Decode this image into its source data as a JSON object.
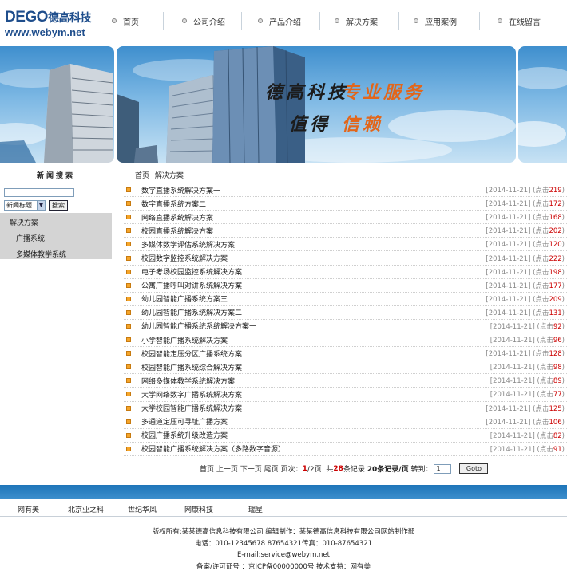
{
  "brand": {
    "name": "DEGO",
    "name_cn": "德高科技",
    "url": "www.webym.net"
  },
  "nav": [
    "首页",
    "公司介绍",
    "产品介绍",
    "解决方案",
    "应用案例",
    "在线留言"
  ],
  "banner": {
    "slogan_line1_a": "德高科技",
    "slogan_line1_b": "专业服务",
    "slogan_line2_a": "值得",
    "slogan_line2_b": "信赖"
  },
  "sidebar": {
    "news_search_title": "新闻搜索",
    "search": {
      "value": "",
      "select": "新闻标题",
      "button": "搜索"
    },
    "categories": [
      "解决方案",
      "广播系统",
      "多媒体教学系统"
    ]
  },
  "breadcrumb": "首页 解决方案",
  "articles": [
    {
      "title": "数字直播系统解决方案一",
      "date": "[2014-11-21]",
      "clicks": "219"
    },
    {
      "title": "数字直播系统方案二",
      "date": "[2014-11-21]",
      "clicks": "172"
    },
    {
      "title": "网络直播系统解决方案",
      "date": "[2014-11-21]",
      "clicks": "168"
    },
    {
      "title": "校园直播系统解决方案",
      "date": "[2014-11-21]",
      "clicks": "202"
    },
    {
      "title": "多媒体数学评估系统解决方案",
      "date": "[2014-11-21]",
      "clicks": "120"
    },
    {
      "title": "校园数字监控系统解决方案",
      "date": "[2014-11-21]",
      "clicks": "222"
    },
    {
      "title": "电子考场校园监控系统解决方案",
      "date": "[2014-11-21]",
      "clicks": "198"
    },
    {
      "title": "公寓广播呼叫对讲系统解决方案",
      "date": "[2014-11-21]",
      "clicks": "177"
    },
    {
      "title": "幼儿园智能广播系统方案三",
      "date": "[2014-11-21]",
      "clicks": "209"
    },
    {
      "title": "幼儿园智能广播系统解决方案二",
      "date": "[2014-11-21]",
      "clicks": "131"
    },
    {
      "title": "幼儿园智能广播系统系统解决方案一",
      "date": "[2014-11-21]",
      "clicks": "92"
    },
    {
      "title": "小学智能广播系统解决方案",
      "date": "[2014-11-21]",
      "clicks": "96"
    },
    {
      "title": "校园智能定压分区广播系统方案",
      "date": "[2014-11-21]",
      "clicks": "128"
    },
    {
      "title": "校园智能广播系统综合解决方案",
      "date": "[2014-11-21]",
      "clicks": "98"
    },
    {
      "title": "网络多媒体教学系统解决方案",
      "date": "[2014-11-21]",
      "clicks": "89"
    },
    {
      "title": "大学网络数字广播系统解决方案",
      "date": "[2014-11-21]",
      "clicks": "77"
    },
    {
      "title": "大学校园智能广播系统解决方案",
      "date": "[2014-11-21]",
      "clicks": "125"
    },
    {
      "title": "多通道定压可寻址广播方案",
      "date": "[2014-11-21]",
      "clicks": "106"
    },
    {
      "title": "校园广播系统升级改造方案",
      "date": "[2014-11-21]",
      "clicks": "82"
    },
    {
      "title": "校园智能广播系统解决方案（多路数字音源）",
      "date": "[2014-11-21]",
      "clicks": "91"
    }
  ],
  "click_prefix": "(点击",
  "click_suffix": ")",
  "pager": {
    "first": "首页",
    "prev": "上一页",
    "next": "下一页",
    "last": "尾页",
    "page_label": "页次：",
    "page_current": "1",
    "page_total": "/2页",
    "total_prefix": "共",
    "total_count": "28",
    "total_suffix": "条记录",
    "per_page": "20条记录/页",
    "jump": "转到：",
    "jump_value": "1",
    "go": "Goto"
  },
  "footer": {
    "links": [
      "网有美",
      "北京业之科",
      "世纪华风",
      "网康科技",
      "瑞星"
    ],
    "copy1": "版权所有:某某德高信息科技有限公司 编辑制作：某某德高信息科技有限公司网站制作部",
    "copy2": "电话：010-12345678 87654321传真：010-87654321",
    "copy3": "E-mail:service@webym.net",
    "copy4": "备案/许可证号 ：京ICP备00000000号 技术支持：网有美"
  },
  "colors": {
    "brand": "#1f4e8c",
    "footer_bar": "#1d74b8",
    "click_count": "#cc0000",
    "bullet": "#f5a52a"
  }
}
